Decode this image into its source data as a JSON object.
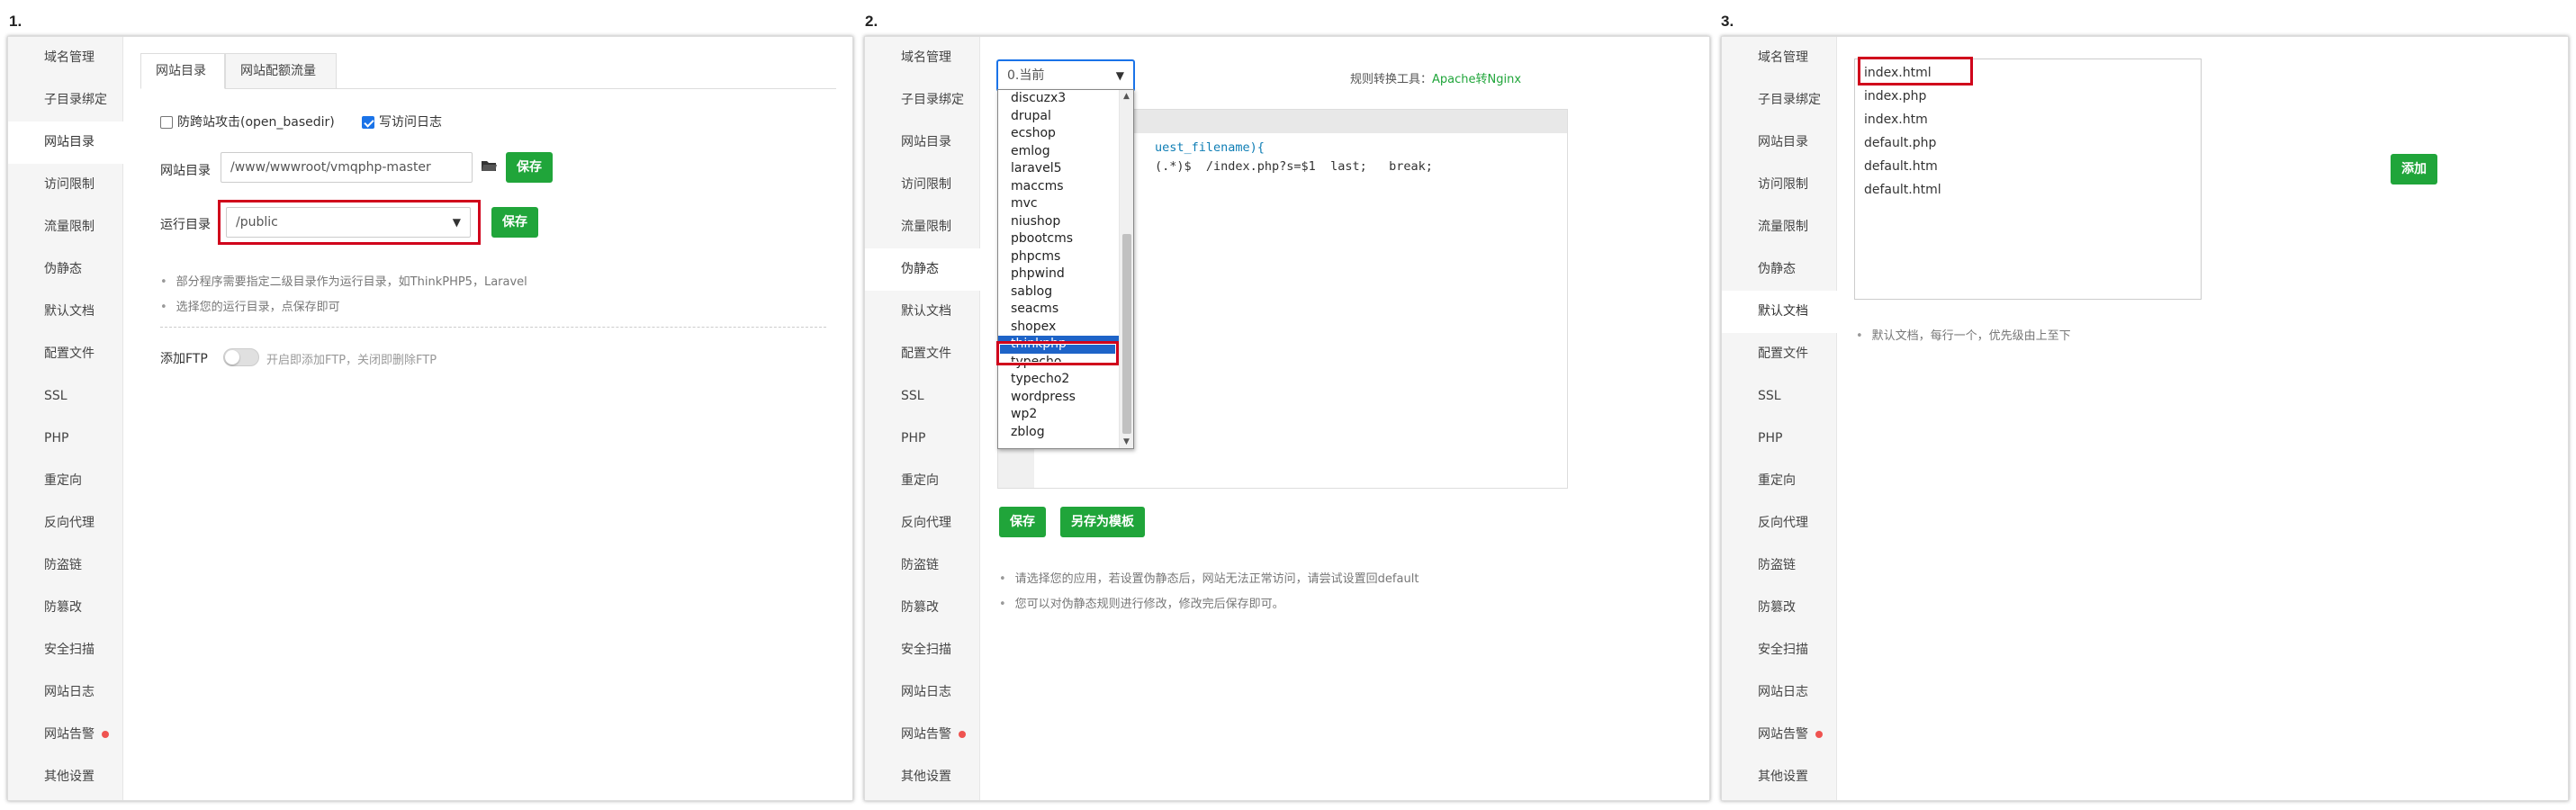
{
  "steps": [
    "1.",
    "2.",
    "3."
  ],
  "sidebar": {
    "items": [
      {
        "label": "域名管理"
      },
      {
        "label": "子目录绑定"
      },
      {
        "label": "网站目录"
      },
      {
        "label": "访问限制"
      },
      {
        "label": "流量限制"
      },
      {
        "label": "伪静态"
      },
      {
        "label": "默认文档"
      },
      {
        "label": "配置文件"
      },
      {
        "label": "SSL"
      },
      {
        "label": "PHP"
      },
      {
        "label": "重定向"
      },
      {
        "label": "反向代理"
      },
      {
        "label": "防盗链"
      },
      {
        "label": "防篡改"
      },
      {
        "label": "安全扫描"
      },
      {
        "label": "网站日志"
      },
      {
        "label": "网站告警"
      },
      {
        "label": "其他设置"
      }
    ]
  },
  "panel1": {
    "tabs": [
      "网站目录",
      "网站配额流量"
    ],
    "anti_xss_label": "防跨站攻击(open_basedir)",
    "write_log_label": "写访问日志",
    "site_dir_label": "网站目录",
    "site_dir_value": "/www/wwwroot/vmqphp-master",
    "run_dir_label": "运行目录",
    "run_dir_value": "/public",
    "save_label": "保存",
    "notes": [
      "部分程序需要指定二级目录作为运行目录，如ThinkPHP5，Laravel",
      "选择您的运行目录，点保存即可"
    ],
    "ftp_label": "添加FTP",
    "ftp_hint": "开启即添加FTP，关闭即删除FTP"
  },
  "panel2": {
    "select_value": "0.当前",
    "convert_label": "规则转换工具：",
    "convert_link": "Apache转Nginx",
    "code_lines": [
      "uest_filename){",
      "(.*)$  /index.php?s=$1  last;   break;"
    ],
    "dropdown_options": [
      "discuzx3",
      "drupal",
      "ecshop",
      "emlog",
      "laravel5",
      "maccms",
      "mvc",
      "niushop",
      "pbootcms",
      "phpcms",
      "phpwind",
      "sablog",
      "seacms",
      "shopex",
      "thinkphp",
      "typecho",
      "typecho2",
      "wordpress",
      "wp2",
      "zblog"
    ],
    "selected_option": "thinkphp",
    "save_label": "保存",
    "save_template_label": "另存为模板",
    "notes": [
      "请选择您的应用，若设置伪静态后，网站无法正常访问，请尝试设置回default",
      "您可以对伪静态规则进行修改，修改完后保存即可。"
    ]
  },
  "panel3": {
    "docs": [
      "index.html",
      "index.php",
      "index.htm",
      "default.php",
      "default.htm",
      "default.html"
    ],
    "add_label": "添加",
    "note": "默认文档，每行一个，优先级由上至下"
  },
  "colors": {
    "accent_green": "#20a53a",
    "highlight_red": "#d0021b",
    "selection_blue": "#1e64c8"
  }
}
